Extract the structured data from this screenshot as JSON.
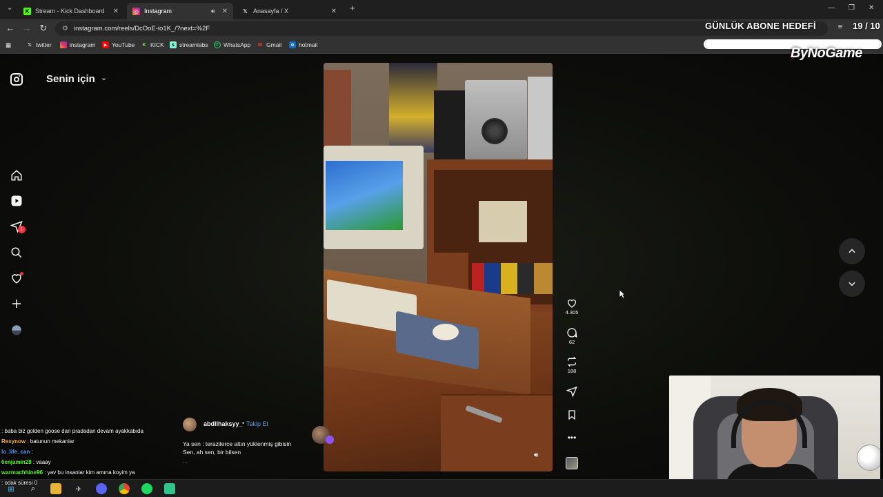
{
  "browser": {
    "tabs": [
      {
        "title": "Stream - Kick Dashboard",
        "icon": "kick-icon",
        "color": "#53fc18"
      },
      {
        "title": "Instagram",
        "icon": "instagram-icon",
        "color": "#e1306c",
        "active": true
      },
      {
        "title": "Anasayfa / X",
        "icon": "x-icon",
        "color": "#ffffff"
      }
    ],
    "url": "instagram.com/reels/DcOoE-io1K_/?next=%2F",
    "bookmarks": [
      {
        "label": "twitter",
        "icon": "x-icon"
      },
      {
        "label": "instagram",
        "icon": "instagram-icon"
      },
      {
        "label": "YouTube",
        "icon": "youtube-icon"
      },
      {
        "label": "KICK",
        "icon": "kick-icon"
      },
      {
        "label": "streamlabs",
        "icon": "streamlabs-icon"
      },
      {
        "label": "WhatsApp",
        "icon": "whatsapp-icon"
      },
      {
        "label": "Gmail",
        "icon": "gmail-icon"
      },
      {
        "label": "hotmail",
        "icon": "outlook-icon"
      }
    ]
  },
  "overlay": {
    "goal_title": "GÜNLÜK ABONE HEDEFİ",
    "goal_count": "19 / 10",
    "goal_progress": 1.0,
    "brand": "ByNoGame"
  },
  "instagram": {
    "feed_title": "Senin için",
    "notifications_badge": "1",
    "reel": {
      "likes": "4.305",
      "comments": "62",
      "reposts": "188",
      "username": "abdllhaksyy_",
      "follow_label": "Takip Et",
      "caption_line1": "Ya sen : terazilerce altın yüklenmiş gibisin",
      "caption_line2": "Sen, ah sen, bir bilsen",
      "caption_more": "..."
    }
  },
  "chat": [
    {
      "user": "",
      "message": ": baba biz golden goose dan pradadan devam ayakkabıda",
      "color": "#ff9a3c"
    },
    {
      "user": "Rexynow",
      "message": ": batunun mekanlar",
      "color": "#ffb347"
    },
    {
      "user": "lo_life_can",
      "message": ":",
      "color": "#4aa3ff"
    },
    {
      "user": "6enjamin28",
      "message": ": vaaay",
      "color": "#53fc18"
    },
    {
      "user": "warmachhine96",
      "message": ": yav bu insanlar kim amına koyim ya",
      "color": "#53fc18"
    },
    {
      "user": "",
      "message": ": odak süresi 0",
      "color": "#4aa3ff"
    }
  ]
}
